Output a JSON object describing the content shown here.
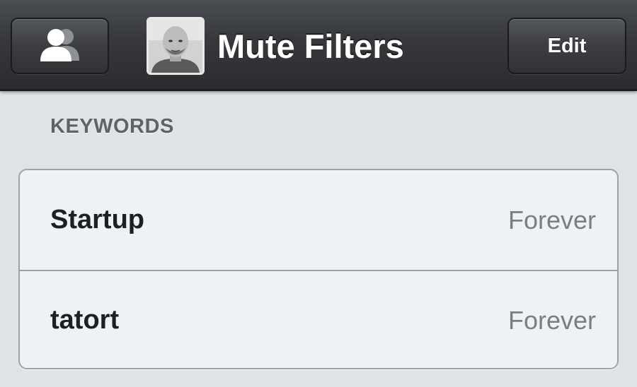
{
  "navbar": {
    "title": "Mute Filters",
    "accounts_icon": "accounts-icon",
    "avatar_icon": "user-avatar",
    "edit_label": "Edit"
  },
  "section": {
    "header": "KEYWORDS"
  },
  "filters": [
    {
      "keyword": "Startup",
      "duration": "Forever"
    },
    {
      "keyword": "tatort",
      "duration": "Forever"
    }
  ],
  "colors": {
    "navbar_bg": "#36383c",
    "page_bg": "#dfe2e7",
    "cell_bg": "#eef1f5",
    "cell_border": "#9ea1a6",
    "detail_text": "#7a7d82"
  }
}
